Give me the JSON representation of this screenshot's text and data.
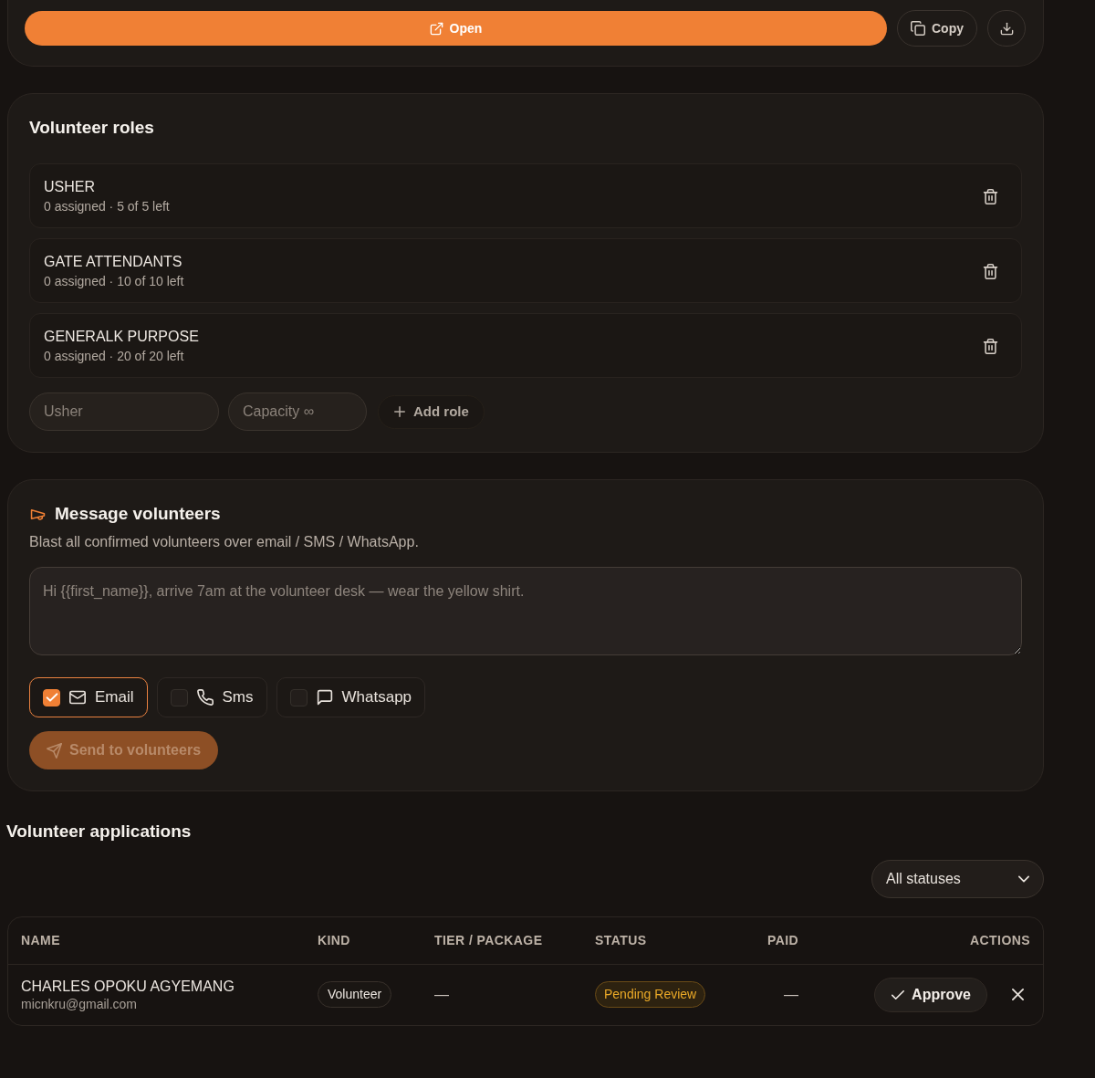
{
  "link_actions": [
    {
      "kind": "primary",
      "label": "Open"
    },
    {
      "kind": "secondary",
      "label": "Copy"
    },
    {
      "kind": "icon"
    }
  ],
  "volunteer_roles": {
    "title": "Volunteer roles",
    "roles": [
      {
        "name": "USHER",
        "summary": "0 assigned · 5 of 5 left"
      },
      {
        "name": "GATE ATTENDANTS",
        "summary": "0 assigned · 10 of 10 left"
      },
      {
        "name": "GENERALK PURPOSE",
        "summary": "0 assigned · 20 of 20 left"
      }
    ],
    "new_role": {
      "name_field": {
        "placeholder": "Usher"
      },
      "capacity_field": {
        "placeholder": "Capacity ∞"
      },
      "add_button": "Add role"
    }
  },
  "message_volunteers": {
    "title": "Message volunteers",
    "subtitle": "Blast all confirmed volunteers over email / SMS / WhatsApp.",
    "message_field": {
      "placeholder": "Hi {{first_name}}, arrive 7am at the volunteer desk — wear the yellow shirt."
    },
    "channels": [
      {
        "label": "Email",
        "checked": true
      },
      {
        "label": "Sms",
        "checked": false
      },
      {
        "label": "Whatsapp",
        "checked": false
      }
    ],
    "send_button": {
      "label": "Send to volunteers",
      "disabled": true
    }
  },
  "applications": {
    "title": "Volunteer applications",
    "status_filter": {
      "value": "All statuses"
    },
    "table": {
      "columns": [
        "NAME",
        "KIND",
        "TIER / PACKAGE",
        "STATUS",
        "PAID",
        "ACTIONS"
      ],
      "rows": [
        {
          "name": "CHARLES OPOKU AGYEMANG",
          "email": "micnkru@gmail.com",
          "kind": "Volunteer",
          "tier": "—",
          "status": "Pending Review",
          "paid": "—",
          "approve_button": "Approve"
        }
      ]
    }
  }
}
